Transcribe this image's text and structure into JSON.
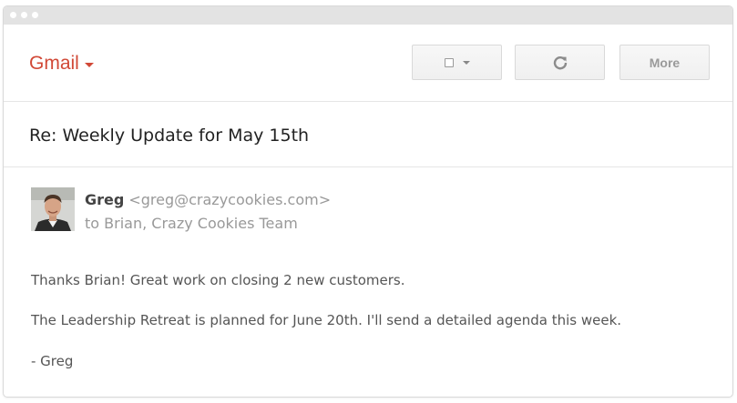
{
  "header": {
    "brand_label": "Gmail",
    "more_label": "More",
    "accent_color": "#d14836"
  },
  "toolbar_icons": {
    "select": "checkbox-icon",
    "select_caret": "chevron-down-icon",
    "refresh": "refresh-icon"
  },
  "email": {
    "subject": "Re: Weekly Update for May 15th",
    "sender_name": "Greg",
    "sender_email": "<greg@crazycookies.com>",
    "recipients": "to Brian, Crazy Cookies Team",
    "body": [
      "Thanks Brian! Great work on closing 2 new customers.",
      "The Leadership Retreat is planned for June 20th. I'll send a detailed agenda this week.",
      "- Greg"
    ]
  }
}
